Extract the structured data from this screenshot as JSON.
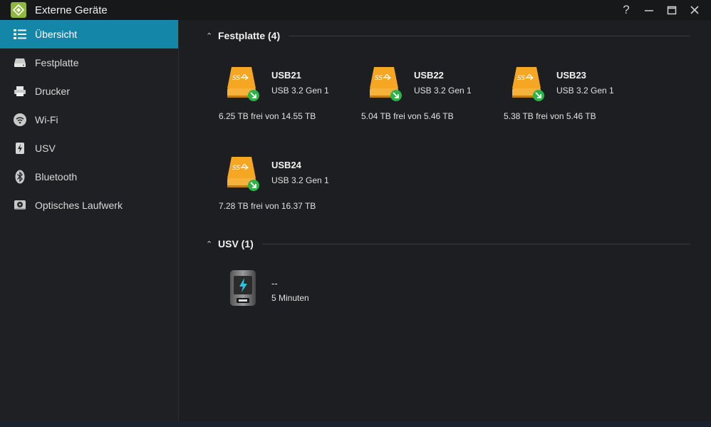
{
  "window": {
    "title": "Externe Geräte",
    "controls": [
      "help-icon",
      "minimize-icon",
      "maximize-icon",
      "close-icon"
    ]
  },
  "sidebar": {
    "items": [
      {
        "label": "Übersicht",
        "icon": "overview-icon",
        "active": true
      },
      {
        "label": "Festplatte",
        "icon": "harddisk-icon"
      },
      {
        "label": "Drucker",
        "icon": "printer-icon"
      },
      {
        "label": "Wi-Fi",
        "icon": "wifi-icon"
      },
      {
        "label": "USV",
        "icon": "ups-icon"
      },
      {
        "label": "Bluetooth",
        "icon": "bluetooth-icon"
      },
      {
        "label": "Optisches Laufwerk",
        "icon": "optical-drive-icon"
      }
    ]
  },
  "sections": {
    "disks": {
      "title": "Festplatte (4)",
      "devices": [
        {
          "name": "USB21",
          "type": "USB 3.2 Gen 1",
          "free": "6.25 TB frei von 14.55 TB"
        },
        {
          "name": "USB22",
          "type": "USB 3.2 Gen 1",
          "free": "5.04 TB frei von 5.46 TB"
        },
        {
          "name": "USB23",
          "type": "USB 3.2 Gen 1",
          "free": "5.38 TB frei von 5.46 TB"
        },
        {
          "name": "USB24",
          "type": "USB 3.2 Gen 1",
          "free": "7.28 TB frei von 16.37 TB"
        }
      ]
    },
    "ups": {
      "title": "USV (1)",
      "device": {
        "name": "--",
        "runtime": "5 Minuten"
      }
    }
  },
  "colors": {
    "accent": "#1486a8",
    "disk_orange": "#f5a623",
    "eject_green": "#2db34a",
    "logo_green": "#8fb73e"
  }
}
